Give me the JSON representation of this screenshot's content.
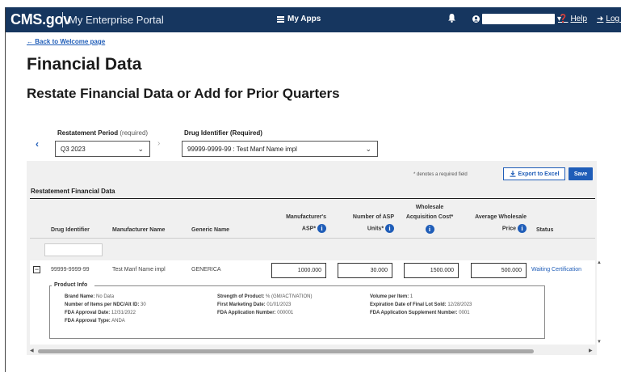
{
  "nav": {
    "brand": "CMS.gov",
    "portal": "My Enterprise Portal",
    "my_apps": "My Apps",
    "help": "Help",
    "logout": "Log Out"
  },
  "page": {
    "back_link": "← Back to Welcome page",
    "title": "Financial Data",
    "subtitle": "Restate Financial Data or Add for Prior Quarters"
  },
  "filters": {
    "period_label": "Restatement Period",
    "period_req": "(required)",
    "period_value": "Q3 2023",
    "drug_label": "Drug Identifier (Required)",
    "drug_value": "99999-9999-99 : Test Manf Name impl"
  },
  "panel": {
    "required_note": "* denotes a required field",
    "export_label": "Export to Excel",
    "save_label": "Save",
    "section_title": "Restatement Financial Data"
  },
  "table": {
    "headers": {
      "drug_identifier": "Drug Identifier",
      "manufacturer_name": "Manufacturer Name",
      "generic_name": "Generic Name",
      "asp_line1": "Manufacturer's",
      "asp_line2": "ASP*",
      "units_line1": "Number of ASP",
      "units_line2": "Units*",
      "wac_line1": "Wholesale",
      "wac_line2": "Acquisition Cost*",
      "awp_line1": "Average Wholesale",
      "awp_line2": "Price",
      "status": "Status"
    },
    "row": {
      "drug_identifier": "99999-9999-99",
      "manufacturer_name": "Test Manf Name impl",
      "generic_name": "GENERICA",
      "asp": "1000.000",
      "units": "30.000",
      "wac": "1500.000",
      "awp": "500.000",
      "status": "Waiting Certification"
    }
  },
  "product_info": {
    "legend": "Product Info",
    "brand_name_label": "Brand Name:",
    "brand_name": "No Data",
    "items_label": "Number of Items per NDC/Alt ID:",
    "items": "30",
    "approval_date_label": "FDA Approval Date:",
    "approval_date": "12/31/2022",
    "approval_type_label": "FDA Approval Type:",
    "approval_type": "ANDA",
    "strength_label": "Strength of Product:",
    "strength": "% (GM/ACTIVATION)",
    "first_marketing_label": "First Marketing Date:",
    "first_marketing": "01/01/2023",
    "app_number_label": "FDA Application Number:",
    "app_number": "000001",
    "volume_label": "Volume per Item:",
    "volume": "1",
    "expiration_label": "Expiration Date of Final Lot Sold:",
    "expiration": "12/28/2023",
    "supplement_label": "FDA Application Supplement Number:",
    "supplement": "0001"
  },
  "icons": {
    "info": "i"
  }
}
